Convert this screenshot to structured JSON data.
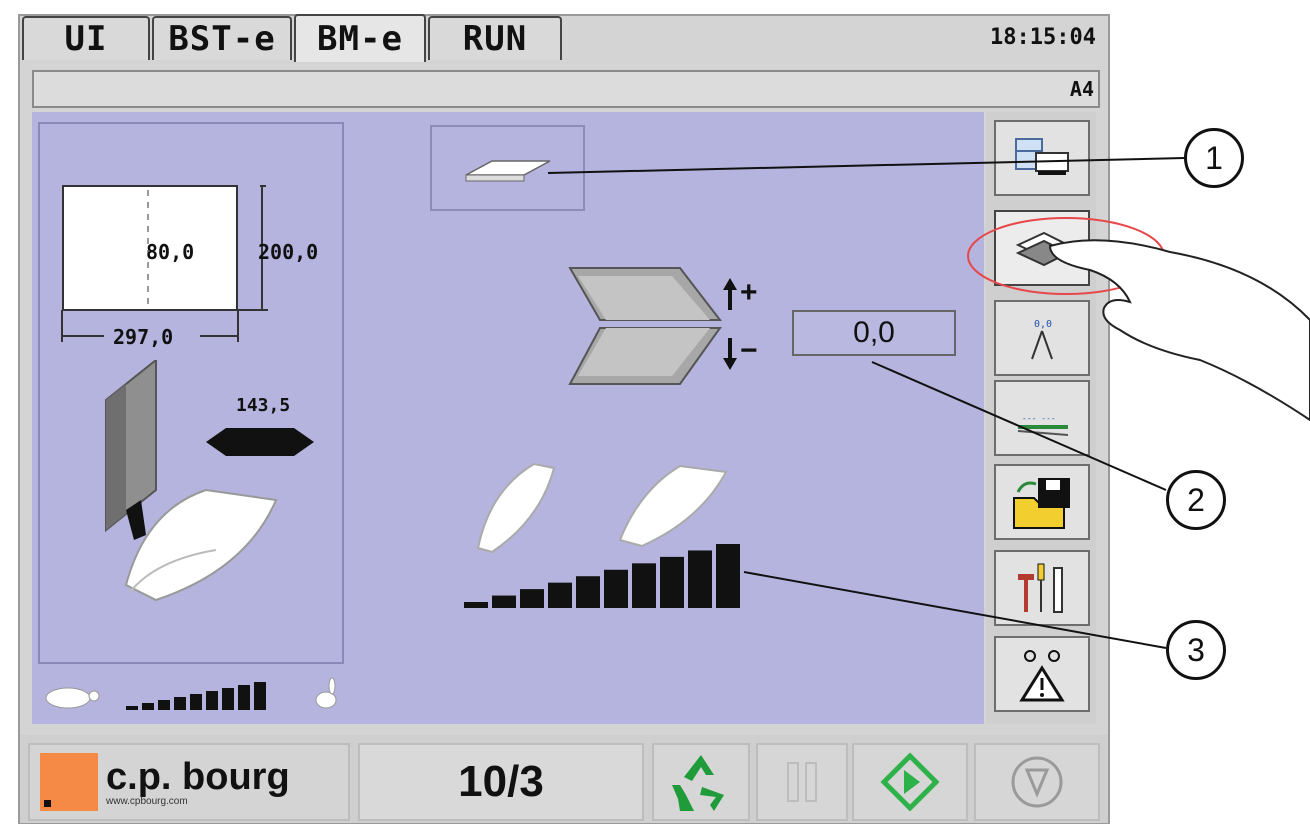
{
  "tabs": [
    {
      "label": "UI"
    },
    {
      "label": "BST-e"
    },
    {
      "label": "BM-e"
    },
    {
      "label": "RUN"
    }
  ],
  "clock": "18:15:04",
  "status": {
    "format": "A4"
  },
  "sheet": {
    "height_mm": "200,0",
    "width_mm": "297,0",
    "fold_position": "80,0",
    "side_guide": "143,5"
  },
  "fold_adjust": {
    "value": "0,0",
    "plus_label": "+",
    "minus_label": "−"
  },
  "speed": {
    "bar_count": 9
  },
  "booklet_speed": {
    "bar_count": 10
  },
  "sidebar": {
    "buttons": [
      {
        "icon": "machine-layout-icon"
      },
      {
        "icon": "fold-setup-icon"
      },
      {
        "icon": "trim-icon"
      },
      {
        "icon": "crease-icon"
      },
      {
        "icon": "folder-save-icon"
      },
      {
        "icon": "tools-icon"
      },
      {
        "icon": "warning-icon"
      }
    ]
  },
  "bottom": {
    "brand": "c.p. bourg",
    "website": "www.cpbourg.com",
    "counter": "10/3"
  },
  "callouts": [
    "1",
    "2",
    "3"
  ],
  "colors": {
    "panel": "#b4b4de",
    "brand_orange": "#f58a46",
    "highlight": "#e8474a",
    "go_green": "#2db24a",
    "recycle_green": "#1f9b3a"
  }
}
